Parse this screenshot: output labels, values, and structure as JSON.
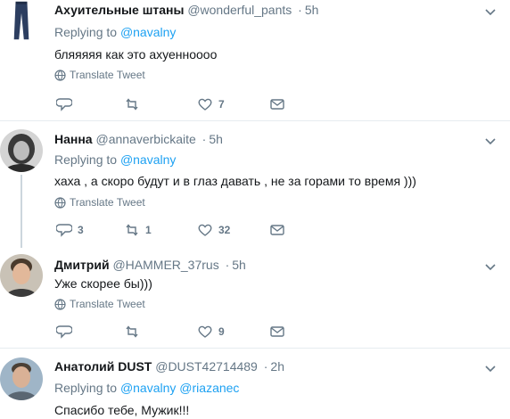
{
  "tweets": [
    {
      "name": "Ахуительные штаны",
      "handle": "@wonderful_pants",
      "dot": "·",
      "time": "5h",
      "replying_prefix": "Replying to",
      "mentions": [
        "@navalny"
      ],
      "text": "бляяяяя как это ахуенноооо",
      "translate": "Translate Tweet",
      "counts": {
        "reply": "",
        "retweet": "",
        "like": "7"
      },
      "avatar": "pants-avatar"
    },
    {
      "name": "Hанна",
      "handle": "@annaverbickaite",
      "dot": "·",
      "time": "5h",
      "replying_prefix": "Replying to",
      "mentions": [
        "@navalny"
      ],
      "text": "хаха , а скоро будут и  в глаз давать , не за горами то время )))",
      "translate": "Translate Tweet",
      "counts": {
        "reply": "3",
        "retweet": "1",
        "like": "32"
      },
      "avatar": "woman-avatar"
    },
    {
      "name": "Дмитрий",
      "handle": "@HAMMER_37rus",
      "dot": "·",
      "time": "5h",
      "text": "Уже скорее бы)))",
      "translate": "Translate Tweet",
      "counts": {
        "reply": "",
        "retweet": "",
        "like": "9"
      },
      "avatar": "man-avatar"
    },
    {
      "name": "Анатолий DUST",
      "handle": "@DUST42714489",
      "dot": "·",
      "time": "2h",
      "replying_prefix": "Replying to",
      "mentions": [
        "@navalny",
        "@riazanec"
      ],
      "text": "Спасибо тебе, Мужик!!!",
      "avatar": "man-avatar-2"
    }
  ],
  "colors": {
    "accent": "#1da1f2",
    "muted": "#657786",
    "text": "#14171a",
    "divider": "#e6ecf0",
    "thread": "#ccd6dd"
  }
}
